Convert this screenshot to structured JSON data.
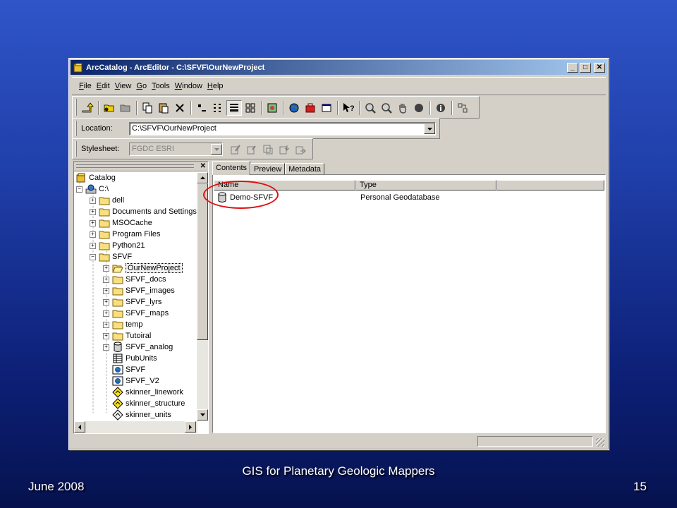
{
  "window": {
    "title": "ArcCatalog - ArcEditor - C:\\SFVF\\OurNewProject",
    "minimize": "_",
    "maximize": "□",
    "close": "✕"
  },
  "menu": [
    "File",
    "Edit",
    "View",
    "Go",
    "Tools",
    "Window",
    "Help"
  ],
  "location": {
    "label": "Location:",
    "value": "C:\\SFVF\\OurNewProject"
  },
  "stylesheet": {
    "label": "Stylesheet:",
    "value": "FGDC ESRI"
  },
  "tree": {
    "close": "✕",
    "items": [
      {
        "label": "Catalog",
        "icon": "catalog-icon"
      },
      {
        "label": "C:\\",
        "icon": "drive-icon"
      },
      {
        "label": "dell",
        "icon": "folder-icon"
      },
      {
        "label": "Documents and Settings",
        "icon": "folder-icon"
      },
      {
        "label": "MSOCache",
        "icon": "folder-icon"
      },
      {
        "label": "Program Files",
        "icon": "folder-icon"
      },
      {
        "label": "Python21",
        "icon": "folder-icon"
      },
      {
        "label": "SFVF",
        "icon": "folder-icon"
      },
      {
        "label": "OurNewProject",
        "icon": "folder-open-icon"
      },
      {
        "label": "SFVF_docs",
        "icon": "folder-icon"
      },
      {
        "label": "SFVF_images",
        "icon": "folder-icon"
      },
      {
        "label": "SFVF_lyrs",
        "icon": "folder-icon"
      },
      {
        "label": "SFVF_maps",
        "icon": "folder-icon"
      },
      {
        "label": "temp",
        "icon": "folder-icon"
      },
      {
        "label": "Tutoiral",
        "icon": "folder-icon"
      },
      {
        "label": "SFVF_analog",
        "icon": "geodatabase-icon"
      },
      {
        "label": "PubUnits",
        "icon": "table-icon"
      },
      {
        "label": "SFVF",
        "icon": "map-document-icon"
      },
      {
        "label": "SFVF_V2",
        "icon": "map-document-icon"
      },
      {
        "label": "skinner_linework",
        "icon": "layer-file-icon"
      },
      {
        "label": "skinner_structure",
        "icon": "layer-file-icon"
      },
      {
        "label": "skinner_units",
        "icon": "layer-file-icon"
      }
    ]
  },
  "tabs": [
    "Contents",
    "Preview",
    "Metadata"
  ],
  "contents": {
    "columns": [
      "Name",
      "Type"
    ],
    "rows": [
      {
        "name": "Demo-SFVF",
        "type": "Personal Geodatabase"
      }
    ]
  },
  "footer": {
    "date": "June 2008",
    "title": "GIS for Planetary Geologic Mappers",
    "page": "15"
  }
}
